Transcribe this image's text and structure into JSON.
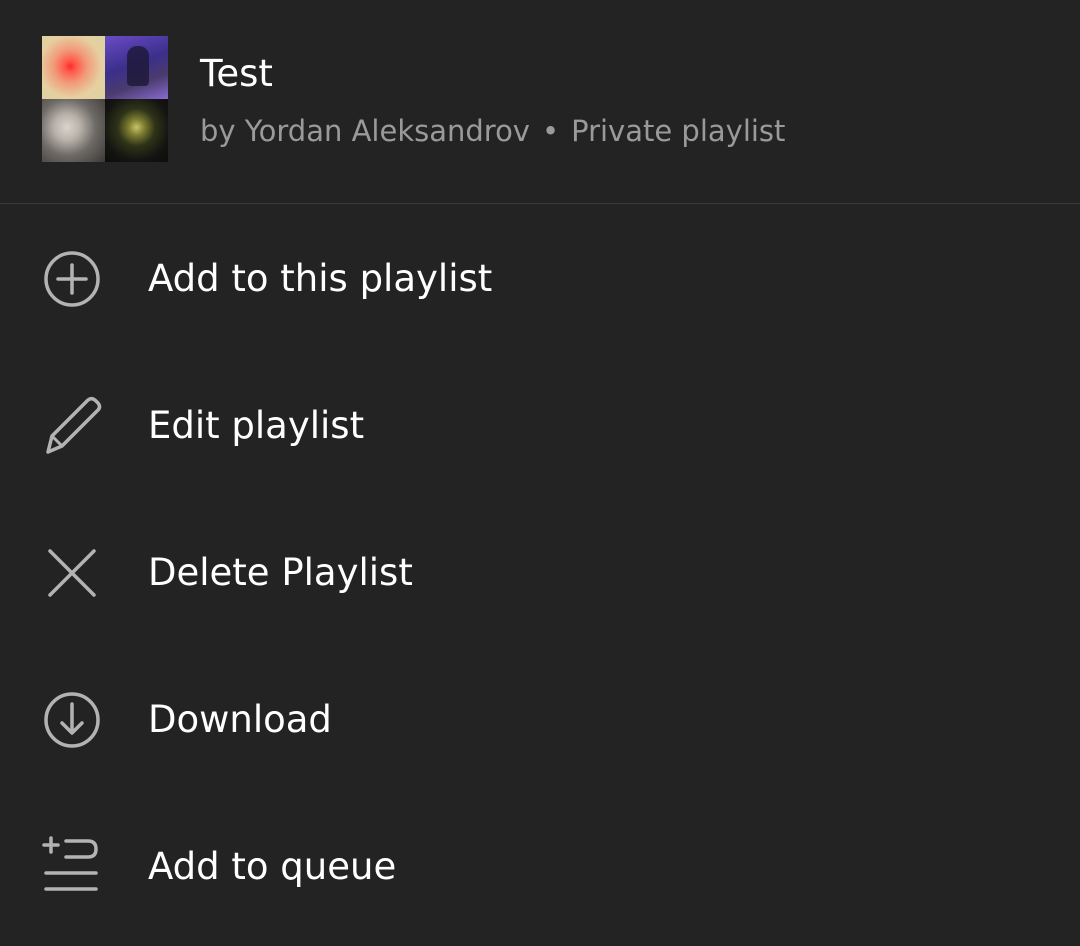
{
  "playlist": {
    "title": "Test",
    "owner": "by Yordan Aleksandrov",
    "separator": "•",
    "visibility": "Private playlist"
  },
  "menu": {
    "items": [
      {
        "label": "Add to this playlist",
        "icon": "plus-circle-icon"
      },
      {
        "label": "Edit playlist",
        "icon": "pencil-icon"
      },
      {
        "label": "Delete Playlist",
        "icon": "close-icon"
      },
      {
        "label": "Download",
        "icon": "download-circle-icon"
      },
      {
        "label": "Add to queue",
        "icon": "add-to-queue-icon"
      }
    ]
  },
  "colors": {
    "background": "#232323",
    "text_primary": "#ffffff",
    "text_secondary": "#9a9a9a",
    "icon": "#b3b3b3",
    "divider": "#3a3a3a"
  }
}
